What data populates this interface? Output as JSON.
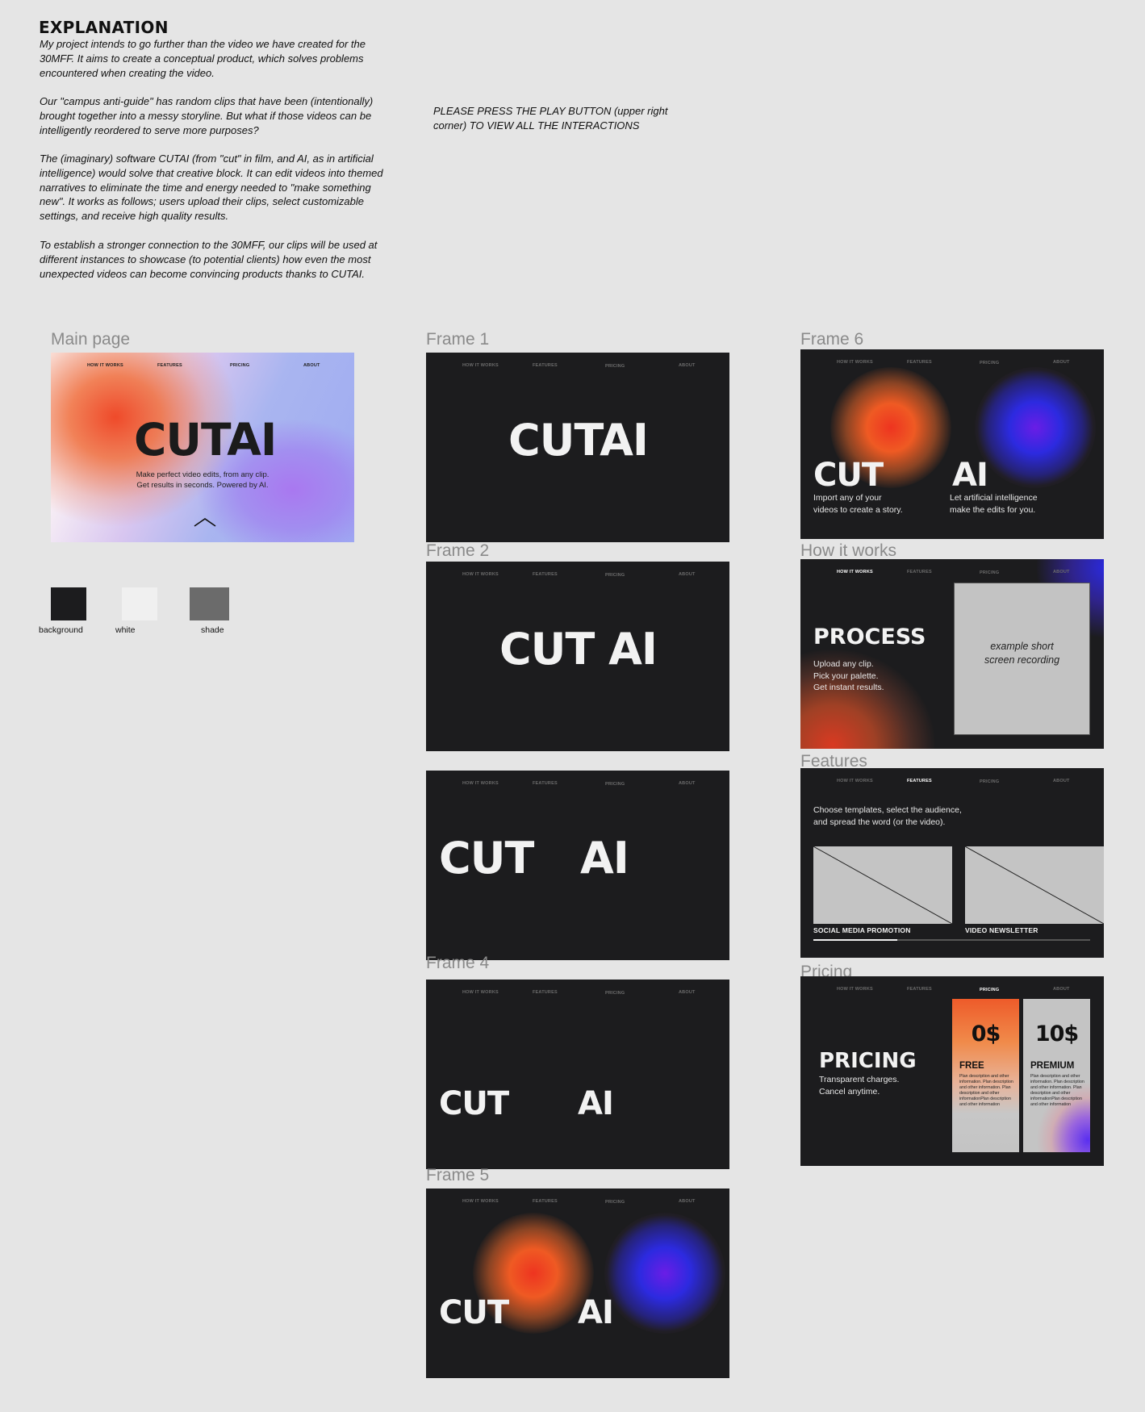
{
  "explanation": {
    "title": "EXPLANATION",
    "p1": "My project intends to go further than the video we have created for the 30MFF. It aims to create a conceptual product, which solves problems encountered when creating the video.",
    "p2": "Our \"campus anti-guide\" has random clips that have been (intentionally) brought together into a messy storyline. But what if those videos can be intelligently reordered to serve more purposes?",
    "p3": "The (imaginary) software CUTAI (from \"cut\" in film, and AI, as in artificial intelligence) would solve that creative block. It can edit videos into themed narratives to eliminate the time and energy needed to \"make something new\". It works as follows; users upload their clips, select customizable settings, and receive high quality results.",
    "p4": "To establish a stronger connection to the 30MFF, our clips will be used at different instances to showcase (to potential clients) how even the most unexpected videos can become convincing products thanks to CUTAI."
  },
  "note": "PLEASE PRESS THE PLAY BUTTON (upper right corner) TO VIEW ALL THE INTERACTIONS",
  "nav": [
    "HOW IT WORKS",
    "FEATURES",
    "PRICING",
    "ABOUT"
  ],
  "frame_labels": {
    "main": "Main page",
    "frame1": "Frame 1",
    "frame2": "Frame 2",
    "frame4": "Frame 4",
    "frame5": "Frame 5",
    "frame6": "Frame 6",
    "how": "How it works",
    "features": "Features",
    "pricing": "Pricing"
  },
  "main_page": {
    "title": "CUTAI",
    "tagline1": "Make perfect video edits, from any clip.",
    "tagline2": "Get results in seconds. Powered by AI."
  },
  "palette": [
    {
      "label": "background",
      "color": "#1c1c1e"
    },
    {
      "label": "white",
      "color": "#f0f0f0"
    },
    {
      "label": "shade",
      "color": "#6b6b6b"
    }
  ],
  "words": {
    "cutai": "CUTAI",
    "cut_ai": "CUT AI",
    "cut": "CUT",
    "ai": "AI"
  },
  "frame6": {
    "cut_desc1": "Import any of your",
    "cut_desc2": "videos to create a story.",
    "ai_desc1": "Let artificial intelligence",
    "ai_desc2": "make the edits for you."
  },
  "how_it_works": {
    "heading": "PROCESS",
    "line1": "Upload any clip.",
    "line2": "Pick your palette.",
    "line3": "Get instant results.",
    "video_line1": "example short",
    "video_line2": "screen recording"
  },
  "features": {
    "line1": "Choose templates, select the audience,",
    "line2": "and spread the word (or the video).",
    "card1": "SOCIAL MEDIA PROMOTION",
    "card2": "VIDEO NEWSLETTER"
  },
  "pricing": {
    "heading": "PRICING",
    "line1": "Transparent charges.",
    "line2": "Cancel anytime.",
    "free_price": "0$",
    "free_name": "FREE",
    "premium_price": "10$",
    "premium_name": "PREMIUM",
    "free_desc": "Plan description and other information. Plan description and other information. Plan description and other informationPlan description and other information",
    "premium_desc": "Plan description and other information. Plan description and other information. Plan description and other informationPlan description and other information"
  }
}
